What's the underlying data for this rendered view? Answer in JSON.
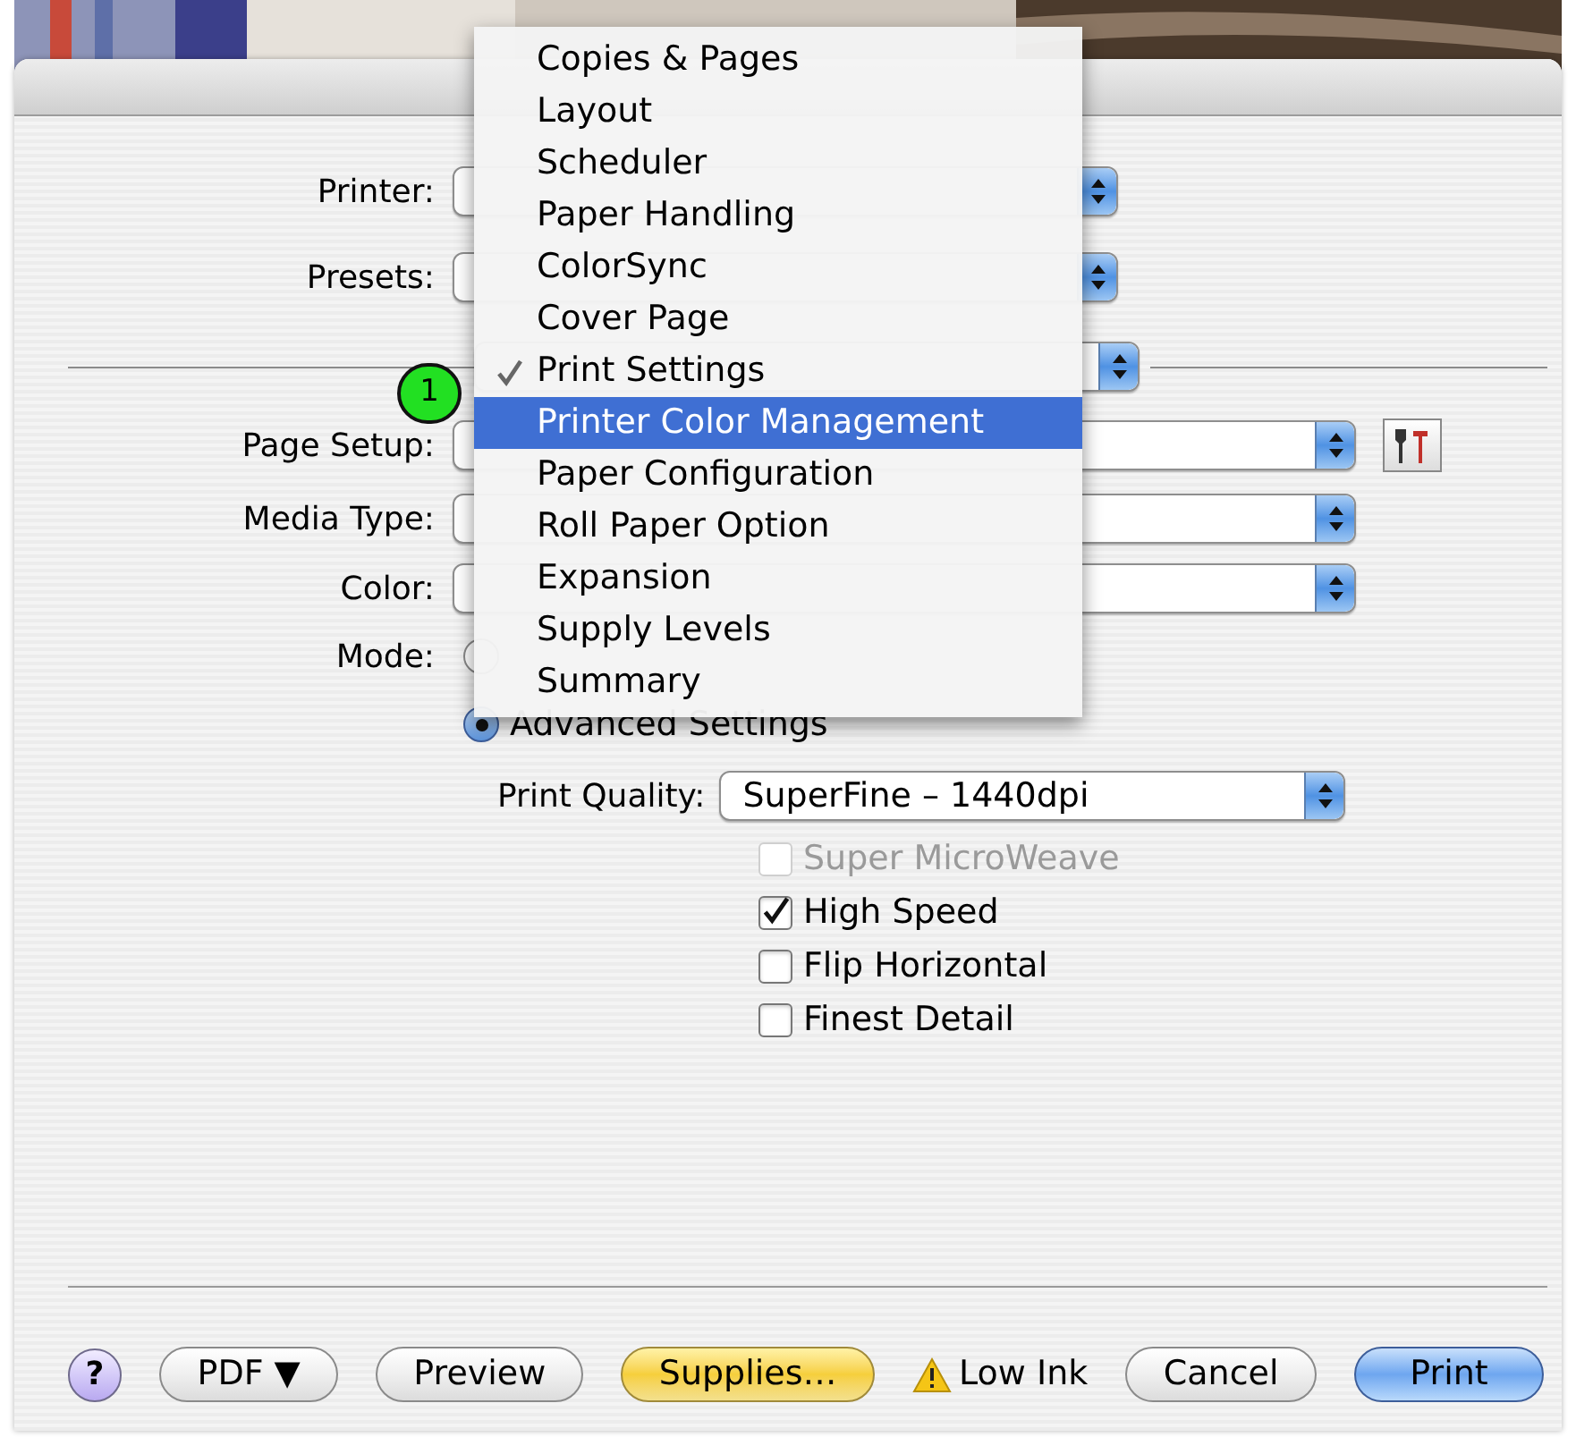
{
  "callout": "1",
  "form": {
    "printer": {
      "label": "Printer:"
    },
    "presets": {
      "label": "Presets:"
    },
    "page_setup": {
      "label": "Page Setup:"
    },
    "media_type": {
      "label": "Media Type:"
    },
    "color": {
      "label": "Color:"
    },
    "mode": {
      "label": "Mode:",
      "options": [
        {
          "selected": false
        },
        {
          "label": "Advanced Settings",
          "selected": true
        }
      ]
    },
    "print_quality": {
      "label": "Print Quality:",
      "value": "SuperFine – 1440dpi"
    },
    "options": [
      {
        "label": "Super MicroWeave",
        "checked": false,
        "disabled": true
      },
      {
        "label": "High Speed",
        "checked": true,
        "disabled": false
      },
      {
        "label": "Flip Horizontal",
        "checked": false,
        "disabled": false
      },
      {
        "label": "Finest Detail",
        "checked": false,
        "disabled": false
      }
    ]
  },
  "menu": {
    "items": [
      {
        "label": "Copies & Pages",
        "checked": false,
        "selected": false
      },
      {
        "label": "Layout",
        "checked": false,
        "selected": false
      },
      {
        "label": "Scheduler",
        "checked": false,
        "selected": false
      },
      {
        "label": "Paper Handling",
        "checked": false,
        "selected": false
      },
      {
        "label": "ColorSync",
        "checked": false,
        "selected": false
      },
      {
        "label": "Cover Page",
        "checked": false,
        "selected": false
      },
      {
        "label": "Print Settings",
        "checked": true,
        "selected": false
      },
      {
        "label": "Printer Color Management",
        "checked": false,
        "selected": true
      },
      {
        "label": "Paper Configuration",
        "checked": false,
        "selected": false
      },
      {
        "label": "Roll Paper Option",
        "checked": false,
        "selected": false
      },
      {
        "label": "Expansion",
        "checked": false,
        "selected": false
      },
      {
        "label": "Supply Levels",
        "checked": false,
        "selected": false
      },
      {
        "label": "Summary",
        "checked": false,
        "selected": false
      }
    ]
  },
  "buttons": [
    {
      "kind": "help",
      "label": "?"
    },
    {
      "kind": "plain",
      "label": "PDF ▼"
    },
    {
      "kind": "plain",
      "label": "Preview"
    },
    {
      "kind": "supplies",
      "label": "Supplies…"
    },
    {
      "kind": "warning",
      "label": "Low Ink"
    },
    {
      "kind": "plain",
      "label": "Cancel"
    },
    {
      "kind": "default",
      "label": "Print"
    }
  ]
}
